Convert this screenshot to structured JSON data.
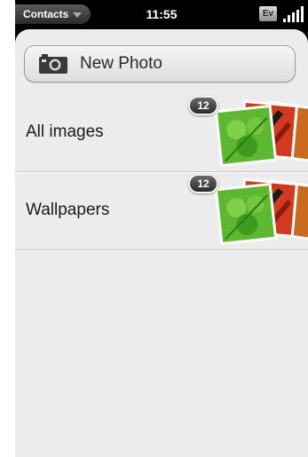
{
  "status_bar": {
    "app_menu_label": "Contacts",
    "time": "11:55",
    "network_label": "Ev"
  },
  "new_photo": {
    "label": "New Photo",
    "icon": "camera-icon"
  },
  "albums": [
    {
      "label": "All images",
      "count": "12"
    },
    {
      "label": "Wallpapers",
      "count": "12"
    }
  ],
  "colors": {
    "background": "#ececec",
    "separator": "#c6c6c6",
    "thumb_green": "#5cb82e",
    "thumb_red": "#d23a1e",
    "thumb_orange": "#c96a1c"
  }
}
